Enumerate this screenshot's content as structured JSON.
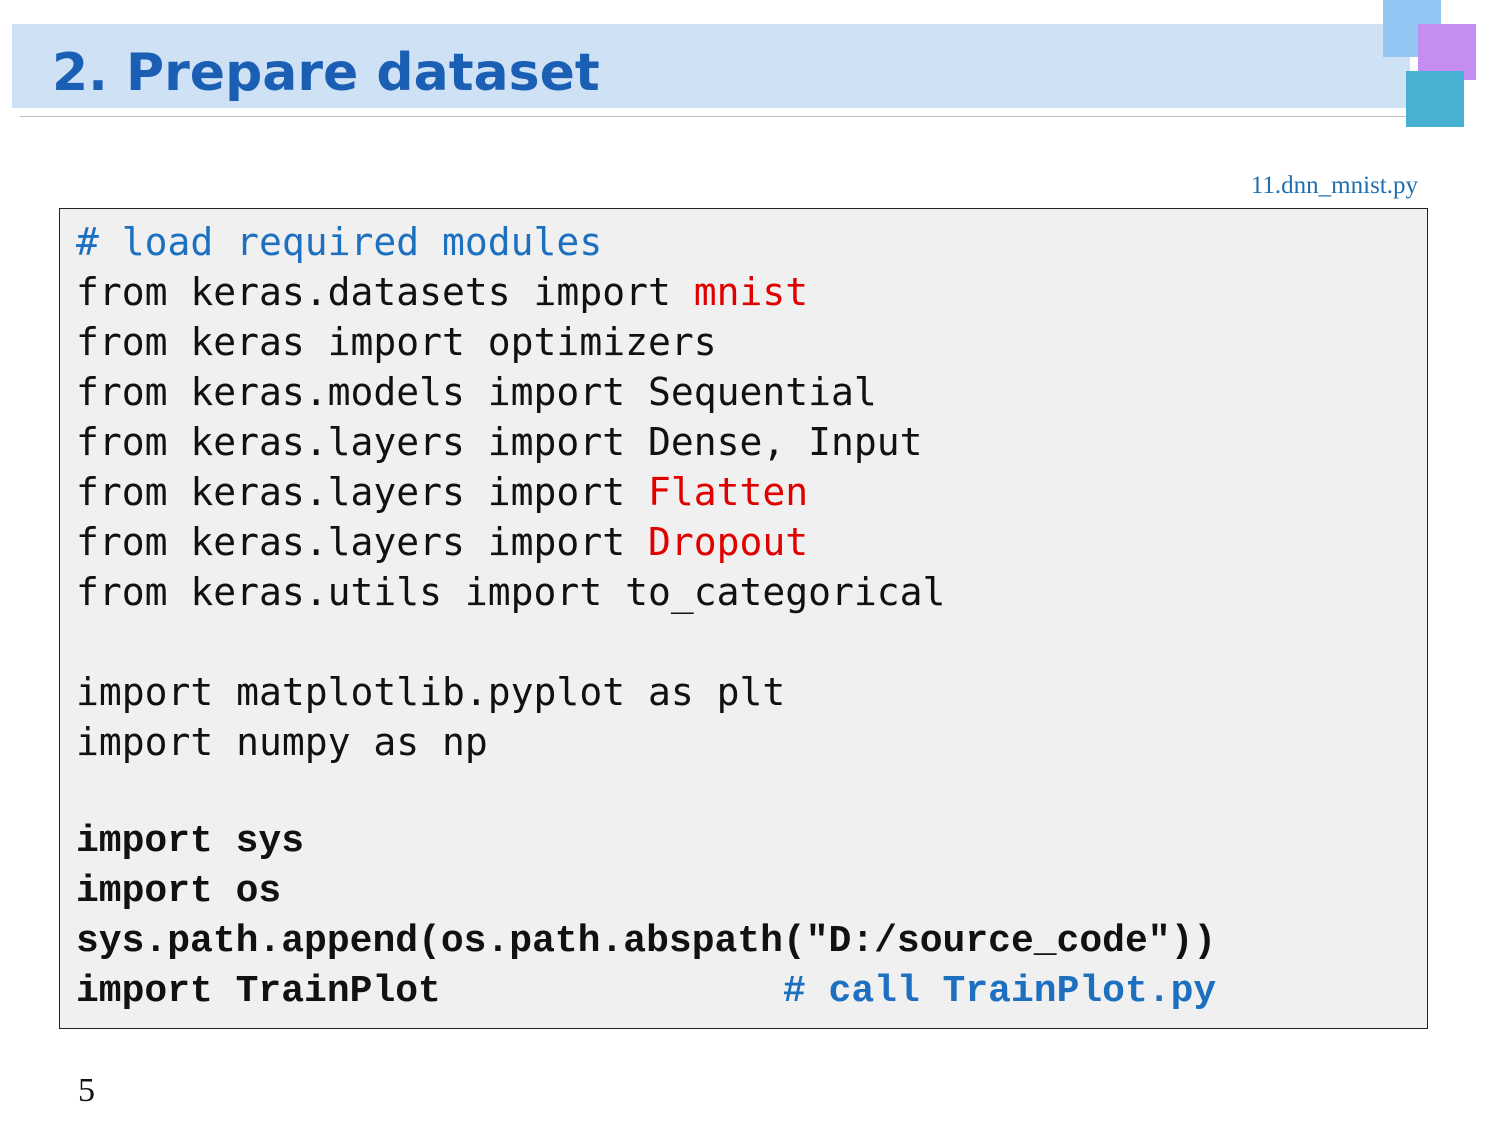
{
  "slide": {
    "title": "2. Prepare dataset",
    "file_label": "11.dnn_mnist.py",
    "page_number": "5"
  },
  "colors": {
    "title_bar": "#cfe1f5",
    "title_text": "#1a5fb4",
    "code_background": "#f0f0f0",
    "comment": "#1d6fc0",
    "highlight": "#e00000",
    "deco_light_blue": "#93c6f2",
    "deco_purple": "#c48ef0",
    "deco_teal": "#46b1d3"
  },
  "code": {
    "line1": {
      "comment": "# load required modules"
    },
    "line2": {
      "prefix": "from keras.datasets import ",
      "highlight": "mnist"
    },
    "line3": {
      "text": "from keras import optimizers"
    },
    "line4": {
      "text": "from keras.models import Sequential"
    },
    "line5": {
      "text": "from keras.layers import Dense, Input"
    },
    "line6": {
      "prefix": "from keras.layers import ",
      "highlight": "Flatten"
    },
    "line7": {
      "prefix": "from keras.layers import ",
      "highlight": "Dropout"
    },
    "line8": {
      "text": "from keras.utils import to_categorical"
    },
    "line10": {
      "text": "import matplotlib.pyplot as plt"
    },
    "line11": {
      "text": "import numpy as np"
    },
    "line13": {
      "text": "import sys"
    },
    "line14": {
      "text": "import os"
    },
    "line15": {
      "text": "sys.path.append(os.path.abspath(\"D:/source_code\"))"
    },
    "line16": {
      "prefix": "import TrainPlot               ",
      "comment": "# call TrainPlot.py"
    }
  }
}
